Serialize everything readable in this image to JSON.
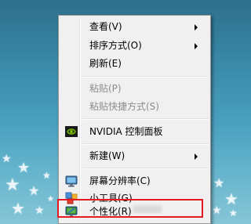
{
  "context_menu": {
    "items": [
      {
        "label": "查看(V)",
        "submenu": true
      },
      {
        "label": "排序方式(O)",
        "submenu": true
      },
      {
        "label": "刷新(E)"
      },
      {
        "label": "粘贴(P)",
        "disabled": true
      },
      {
        "label": "粘贴快捷方式(S)",
        "disabled": true
      },
      {
        "label": "NVIDIA 控制面板",
        "icon": "nvidia-icon"
      },
      {
        "label": "新建(W)",
        "submenu": true
      },
      {
        "label": "屏幕分辨率(C)",
        "icon": "monitor-icon"
      },
      {
        "label": "小工具(G)",
        "icon": "gadgets-icon"
      },
      {
        "label": "个性化(R)",
        "icon": "personalize-icon"
      }
    ]
  },
  "colors": {
    "menu_background": "#f0f0f0",
    "disabled_text": "#8d8d8d",
    "highlight_border": "#e51b24",
    "nvidia_green": "#76b900"
  }
}
